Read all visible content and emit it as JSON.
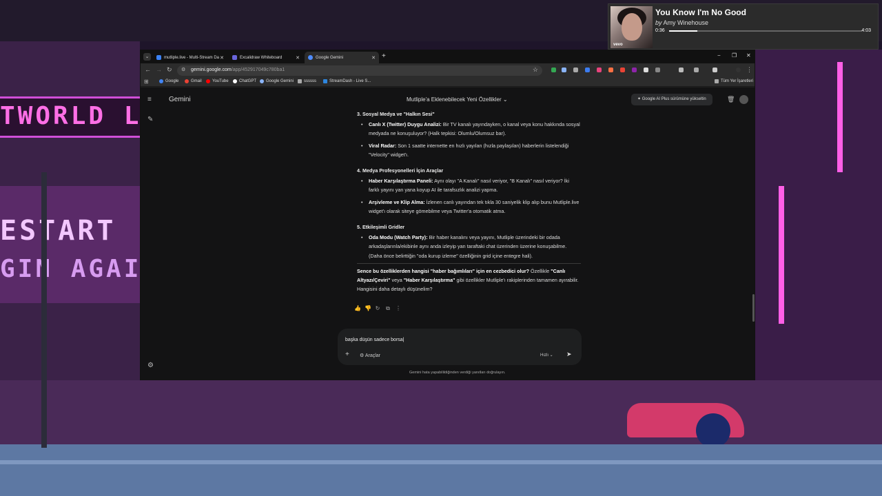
{
  "media": {
    "title": "You Know I'm No Good",
    "artist_prefix": "by",
    "artist": "Amy Winehouse",
    "time_current": "0:36",
    "time_total": "4:03",
    "progress": 0.148,
    "cover_label": "vevo"
  },
  "wallpaper": {
    "sign_left": "TWORLD L",
    "sign_restart": "ESTART",
    "sign_again": "GIN AGAIN"
  },
  "browser": {
    "tabs": [
      {
        "label": "mutliple.live - Multi-Stream Da",
        "active": false,
        "color": "#3b82f6"
      },
      {
        "label": "Excalidraw Whiteboard",
        "active": false,
        "color": "#6965db"
      },
      {
        "label": "Google Gemini",
        "active": true,
        "color": "#4e8cff"
      }
    ],
    "url_host": "gemini.google.com",
    "url_path": "/app/452917049c780ba1",
    "bookmarks": [
      {
        "label": "Google",
        "color": "#4285f4"
      },
      {
        "label": "Gmail",
        "color": "#ea4335"
      },
      {
        "label": "YouTube",
        "color": "#ff0000"
      },
      {
        "label": "ChatGPT",
        "color": "#ffffff"
      },
      {
        "label": "Google Gemini",
        "color": "#8ab4f8"
      },
      {
        "label": "ssssss",
        "color": "#aaaaaa"
      },
      {
        "label": "StreamDash - Live S...",
        "color": "#2e86de"
      }
    ],
    "all_bookmarks": "Tüm Yer İşaretleri"
  },
  "gemini": {
    "app_name": "Gemini",
    "chat_title": "Mutliple'a Eklenebilecek Yeni Özellikler",
    "upgrade_label": "Google AI Plus sürümüne yükseltin",
    "sections": [
      {
        "heading": "3. Sosyal Medya ve \"Halkın Sesi\"",
        "items": [
          {
            "bold": "Canlı X (Twitter) Duygu Analizi:",
            "text": " Bir TV kanalı yayındayken, o kanal veya konu hakkında sosyal medyada ne konuşuluyor? (Halk tepkisi: Olumlu/Olumsuz bar)."
          },
          {
            "bold": "Viral Radar:",
            "text": " Son 1 saatte internette en hızlı yayılan (hızla paylaşılan) haberlerin listelendiği \"Velocity\" widget'ı."
          }
        ]
      },
      {
        "heading": "4. Medya Profesyonelleri İçin Araçlar",
        "items": [
          {
            "bold": "Haber Karşılaştırma Paneli:",
            "text": " Aynı olayı \"A Kanalı\" nasıl veriyor, \"B Kanalı\" nasıl veriyor? İki farklı yayını yan yana koyup AI ile tarafsızlık analizi yapma."
          },
          {
            "bold": "Arşivleme ve Klip Alma:",
            "text": " İzlenen canlı yayından tek tıkla 30 saniyelik klip alıp bunu Mutliple.live widget'ı olarak siteye gömebilme veya Twitter'a otomatik atma."
          }
        ]
      },
      {
        "heading": "5. Etkileşimli Gridler",
        "items": [
          {
            "bold": "Oda Modu (Watch Party):",
            "text": " Bir haber kanalını veya yayını, Mutliple üzerindeki bir odada arkadaşlarınla/ekibinle aynı anda izleyip yan taraftaki chat üzerinden üzerine konuşabilme. (Daha önce belirttiğin \"oda kurup izleme\" özelliğinin grid içine entegre hali)."
          }
        ]
      }
    ],
    "closing": {
      "b1": "Sence bu özelliklerden hangisi \"haber bağımlıları\" için en cezbedici olur?",
      "t1": " Özellikle ",
      "b2": "\"Canlı Altyazı/Çeviri\"",
      "t2": " veya ",
      "b3": "\"Haber Karşılaştırma\"",
      "t3": " gibi özellikler Mutliple'ı rakiplerinden tamamen ayırabilir. Hangisini daha detaylı düşünelim?"
    },
    "input_value": "başka düşün sadece borsa",
    "tools_label": "Araçlar",
    "speed_label": "Hızlı",
    "disclaimer": "Gemini hata yapabilildiğinden verdiği yanıtları doğrulayın."
  }
}
